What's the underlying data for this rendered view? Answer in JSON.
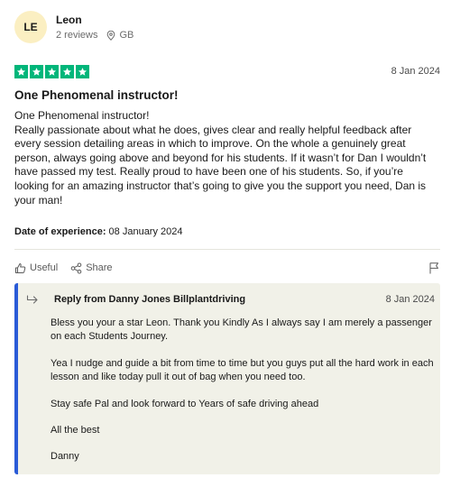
{
  "reviewer": {
    "initials": "LE",
    "name": "Leon",
    "review_count": "2 reviews",
    "country": "GB"
  },
  "review": {
    "rating": 5,
    "date": "8 Jan 2024",
    "title": "One Phenomenal instructor!",
    "body_lines": [
      "One Phenomenal instructor!",
      "Really passionate about what he does, gives clear and really helpful feedback after every session detailing areas in which to improve. On the whole a genuinely great person, always going above and beyond for his students. If it wasn’t for Dan I wouldn’t have passed my test. Really proud to have been one of his students. So, if you’re looking for an amazing instructor that’s going to give you the support you need, Dan is your man!"
    ],
    "experience_label": "Date of experience:",
    "experience_date": "08 January 2024"
  },
  "actions": {
    "useful_label": "Useful",
    "share_label": "Share"
  },
  "reply": {
    "from": "Reply from Danny Jones Billplantdriving",
    "date": "8 Jan 2024",
    "paragraphs": [
      "Bless you your a star Leon. Thank you Kindly As I always say I am merely a passenger on each Students Journey.",
      "Yea I nudge and guide a bit from time to time but you guys put all the hard work in each lesson and like today pull it out of bag when you need too.",
      "Stay safe Pal and look forward to Years of safe driving ahead",
      "All the best",
      "Danny"
    ]
  },
  "colors": {
    "star": "#00b67a",
    "avatar_bg": "#fbefc2",
    "reply_bg": "#f1f1e8",
    "reply_accent": "#2a5bd7"
  },
  "icons": {
    "location": "location-pin-icon",
    "useful": "thumbs-up-icon",
    "share": "share-icon",
    "flag": "flag-icon",
    "reply": "reply-arrow-icon",
    "star": "star-icon"
  }
}
